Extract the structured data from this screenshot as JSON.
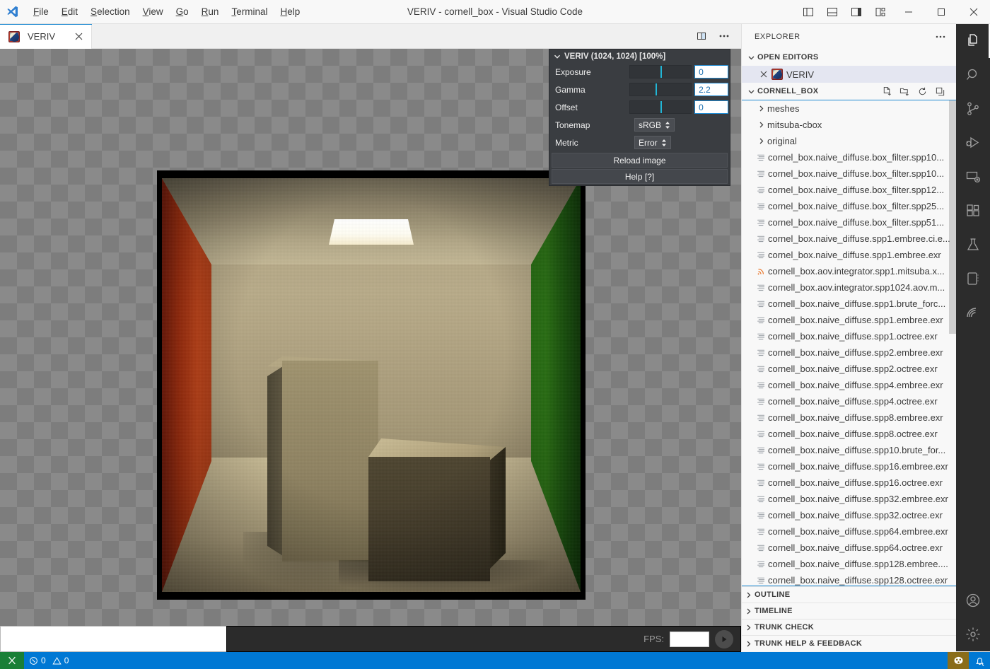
{
  "window": {
    "title": "VERIV - cornell_box - Visual Studio Code",
    "logo_icon": "vscode-logo-icon",
    "minimize_icon": "minimize-icon",
    "maximize_icon": "maximize-icon",
    "close_icon": "close-icon",
    "layout_toggles": [
      {
        "name": "toggle-primary-sidebar-icon",
        "label": "Toggle Primary Side Bar"
      },
      {
        "name": "toggle-panel-icon",
        "label": "Toggle Panel"
      },
      {
        "name": "toggle-secondary-sidebar-icon",
        "label": "Toggle Secondary Side Bar"
      },
      {
        "name": "customize-layout-icon",
        "label": "Customize Layout"
      }
    ]
  },
  "menu": [
    {
      "label": "File",
      "accel": "F"
    },
    {
      "label": "Edit",
      "accel": "E"
    },
    {
      "label": "Selection",
      "accel": "S"
    },
    {
      "label": "View",
      "accel": "V"
    },
    {
      "label": "Go",
      "accel": "G"
    },
    {
      "label": "Run",
      "accel": "R"
    },
    {
      "label": "Terminal",
      "accel": "T"
    },
    {
      "label": "Help",
      "accel": "H"
    }
  ],
  "activitybar": {
    "items": [
      {
        "name": "explorer",
        "icon": "files-icon",
        "active": true
      },
      {
        "name": "search",
        "icon": "search-icon",
        "active": false
      },
      {
        "name": "source-control",
        "icon": "source-control-icon",
        "active": false
      },
      {
        "name": "run-and-debug",
        "icon": "run-debug-icon",
        "active": false
      },
      {
        "name": "remote-explorer",
        "icon": "remote-explorer-icon",
        "active": false
      },
      {
        "name": "extensions",
        "icon": "extensions-icon",
        "active": false
      },
      {
        "name": "testing",
        "icon": "beaker-icon",
        "active": false
      },
      {
        "name": "notebook",
        "icon": "notebook-icon",
        "active": false
      },
      {
        "name": "trunk",
        "icon": "trunk-icon",
        "active": false
      }
    ],
    "bottom": [
      {
        "name": "accounts",
        "icon": "account-icon"
      },
      {
        "name": "settings",
        "icon": "gear-icon"
      }
    ]
  },
  "editor_tabs": {
    "tabs": [
      {
        "label": "VERIV",
        "icon": "veriv-file-icon",
        "active": true,
        "close_icon": "close-icon"
      }
    ],
    "actions": [
      {
        "name": "split-editor",
        "icon": "split-editor-icon"
      },
      {
        "name": "more-actions",
        "icon": "ellipsis-icon"
      }
    ]
  },
  "explorer": {
    "title": "EXPLORER",
    "more_icon": "ellipsis-icon",
    "open_editors": {
      "label": "OPEN EDITORS",
      "items": [
        {
          "label": "VERIV",
          "icon": "veriv-file-icon",
          "close_icon": "close-icon",
          "selected": true
        }
      ]
    },
    "folder": {
      "label": "CORNELL_BOX",
      "actions": [
        {
          "name": "new-file",
          "icon": "new-file-icon"
        },
        {
          "name": "new-folder",
          "icon": "new-folder-icon"
        },
        {
          "name": "refresh-explorer",
          "icon": "refresh-icon"
        },
        {
          "name": "collapse-folders",
          "icon": "collapse-all-icon"
        }
      ]
    },
    "entries": [
      {
        "label": "meshes",
        "type": "folder"
      },
      {
        "label": "mitsuba-cbox",
        "type": "folder"
      },
      {
        "label": "original",
        "type": "folder"
      },
      {
        "label": "cornel_box.naive_diffuse.box_filter.spp10...",
        "type": "file",
        "icon": "lines-icon"
      },
      {
        "label": "cornel_box.naive_diffuse.box_filter.spp10...",
        "type": "file",
        "icon": "lines-icon"
      },
      {
        "label": "cornel_box.naive_diffuse.box_filter.spp12...",
        "type": "file",
        "icon": "lines-icon"
      },
      {
        "label": "cornel_box.naive_diffuse.box_filter.spp25...",
        "type": "file",
        "icon": "lines-icon"
      },
      {
        "label": "cornel_box.naive_diffuse.box_filter.spp51...",
        "type": "file",
        "icon": "lines-icon"
      },
      {
        "label": "cornel_box.naive_diffuse.spp1.embree.ci.e...",
        "type": "file",
        "icon": "lines-icon"
      },
      {
        "label": "cornel_box.naive_diffuse.spp1.embree.exr",
        "type": "file",
        "icon": "lines-icon"
      },
      {
        "label": "cornell_box.aov.integrator.spp1.mitsuba.x...",
        "type": "file",
        "icon": "xml-icon"
      },
      {
        "label": "cornell_box.aov.integrator.spp1024.aov.m...",
        "type": "file",
        "icon": "lines-icon"
      },
      {
        "label": "cornell_box.naive_diffuse.spp1.brute_forc...",
        "type": "file",
        "icon": "lines-icon"
      },
      {
        "label": "cornell_box.naive_diffuse.spp1.embree.exr",
        "type": "file",
        "icon": "lines-icon"
      },
      {
        "label": "cornell_box.naive_diffuse.spp1.octree.exr",
        "type": "file",
        "icon": "lines-icon"
      },
      {
        "label": "cornell_box.naive_diffuse.spp2.embree.exr",
        "type": "file",
        "icon": "lines-icon"
      },
      {
        "label": "cornell_box.naive_diffuse.spp2.octree.exr",
        "type": "file",
        "icon": "lines-icon"
      },
      {
        "label": "cornell_box.naive_diffuse.spp4.embree.exr",
        "type": "file",
        "icon": "lines-icon"
      },
      {
        "label": "cornell_box.naive_diffuse.spp4.octree.exr",
        "type": "file",
        "icon": "lines-icon"
      },
      {
        "label": "cornell_box.naive_diffuse.spp8.embree.exr",
        "type": "file",
        "icon": "lines-icon"
      },
      {
        "label": "cornell_box.naive_diffuse.spp8.octree.exr",
        "type": "file",
        "icon": "lines-icon"
      },
      {
        "label": "cornell_box.naive_diffuse.spp10.brute_for...",
        "type": "file",
        "icon": "lines-icon"
      },
      {
        "label": "cornell_box.naive_diffuse.spp16.embree.exr",
        "type": "file",
        "icon": "lines-icon"
      },
      {
        "label": "cornell_box.naive_diffuse.spp16.octree.exr",
        "type": "file",
        "icon": "lines-icon"
      },
      {
        "label": "cornell_box.naive_diffuse.spp32.embree.exr",
        "type": "file",
        "icon": "lines-icon"
      },
      {
        "label": "cornell_box.naive_diffuse.spp32.octree.exr",
        "type": "file",
        "icon": "lines-icon"
      },
      {
        "label": "cornell_box.naive_diffuse.spp64.embree.exr",
        "type": "file",
        "icon": "lines-icon"
      },
      {
        "label": "cornell_box.naive_diffuse.spp64.octree.exr",
        "type": "file",
        "icon": "lines-icon"
      },
      {
        "label": "cornell_box.naive_diffuse.spp128.embree....",
        "type": "file",
        "icon": "lines-icon"
      },
      {
        "label": "cornell_box.naive_diffuse.spp128.octree.exr",
        "type": "file",
        "icon": "lines-icon"
      }
    ],
    "bottom_sections": [
      {
        "label": "OUTLINE"
      },
      {
        "label": "TIMELINE"
      },
      {
        "label": "TRUNK CHECK"
      },
      {
        "label": "TRUNK HELP & FEEDBACK"
      }
    ]
  },
  "veriv_panel": {
    "header": "VERIV (1024, 1024) [100%]",
    "collapse_icon": "chevron-down-icon",
    "controls": [
      {
        "label": "Exposure",
        "value": "0",
        "slider_pct": 50
      },
      {
        "label": "Gamma",
        "value": "2.2",
        "slider_pct": 42
      },
      {
        "label": "Offset",
        "value": "0",
        "slider_pct": 50
      }
    ],
    "selects": [
      {
        "label": "Tonemap",
        "value": "sRGB",
        "icon": "updown-arrows-icon"
      },
      {
        "label": "Metric",
        "value": "Error",
        "icon": "updown-arrows-icon"
      }
    ],
    "buttons": [
      {
        "label": "Reload image",
        "name": "reload-image-button"
      },
      {
        "label": "Help [?]",
        "name": "help-button"
      }
    ]
  },
  "viewer": {
    "image_name": "VERIV",
    "resolution": "(1024, 1024)",
    "zoom": "100%",
    "fps_label": "FPS:",
    "fps_value": "",
    "fps_placeholder": "",
    "play_icon": "play-icon"
  },
  "statusbar": {
    "remote_icon": "remote-connection-icon",
    "errors_icon": "error-icon",
    "errors": "0",
    "warnings_icon": "warning-icon",
    "warnings": "0",
    "right_items": [
      {
        "name": "trunk-status",
        "icon": "trunk-badge-icon"
      },
      {
        "name": "notifications",
        "icon": "bell-dot-icon"
      }
    ]
  },
  "colors": {
    "accent": "#0078d4",
    "panel_bg": "#3a3d41",
    "slider_handle": "#22b6d6",
    "remote_green": "#1a7f37",
    "cornell_red": "#b53f16",
    "cornell_green": "#2e7a16"
  }
}
